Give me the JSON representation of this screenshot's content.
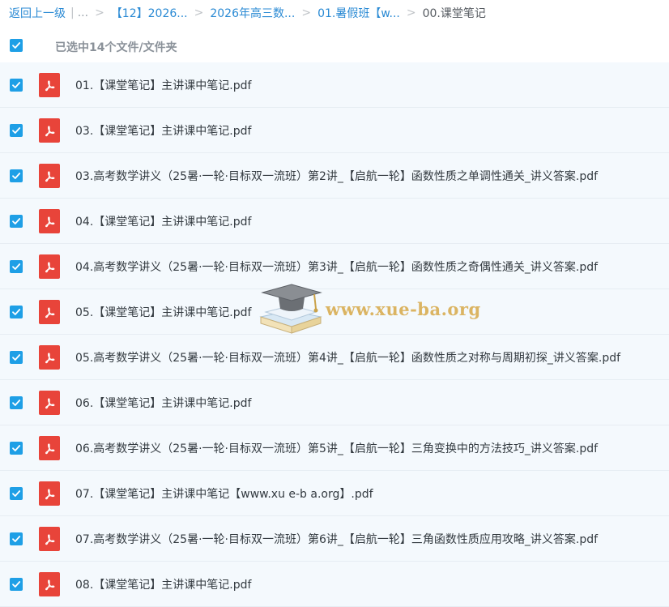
{
  "breadcrumb": {
    "back": "返回上一级",
    "ellipsis": "...",
    "crumbs": [
      "【12】2026...",
      "2026年高三数...",
      "01.暑假班【w..."
    ],
    "current": "00.课堂笔记"
  },
  "selection": {
    "text": "已选中14个文件/文件夹",
    "checked": true
  },
  "files": [
    {
      "name": "01.【课堂笔记】主讲课中笔记.pdf",
      "checked": true
    },
    {
      "name": "03.【课堂笔记】主讲课中笔记.pdf",
      "checked": true
    },
    {
      "name": "03.高考数学讲义（25暑·一轮·目标双一流班）第2讲_【启航一轮】函数性质之单调性通关_讲义答案.pdf",
      "checked": true
    },
    {
      "name": "04.【课堂笔记】主讲课中笔记.pdf",
      "checked": true
    },
    {
      "name": "04.高考数学讲义（25暑·一轮·目标双一流班）第3讲_【启航一轮】函数性质之奇偶性通关_讲义答案.pdf",
      "checked": true
    },
    {
      "name": "05.【课堂笔记】主讲课中笔记.pdf",
      "checked": true
    },
    {
      "name": "05.高考数学讲义（25暑·一轮·目标双一流班）第4讲_【启航一轮】函数性质之对称与周期初探_讲义答案.pdf",
      "checked": true
    },
    {
      "name": "06.【课堂笔记】主讲课中笔记.pdf",
      "checked": true
    },
    {
      "name": "06.高考数学讲义（25暑·一轮·目标双一流班）第5讲_【启航一轮】三角变换中的方法技巧_讲义答案.pdf",
      "checked": true
    },
    {
      "name": "07.【课堂笔记】主讲课中笔记【www.xu e-b a.org】.pdf",
      "checked": true
    },
    {
      "name": "07.高考数学讲义（25暑·一轮·目标双一流班）第6讲_【启航一轮】三角函数性质应用攻略_讲义答案.pdf",
      "checked": true
    },
    {
      "name": "08.【课堂笔记】主讲课中笔记.pdf",
      "checked": true
    }
  ],
  "watermark": {
    "text": "www.xue-ba.org"
  },
  "icons": {
    "checkbox": "checkmark-icon",
    "file": "pdf-file-icon",
    "watermark": "graduation-cap-books-icon"
  },
  "colors": {
    "link": "#2a8ad4",
    "checkbox": "#1e9fe6",
    "pdf": "#e8443a",
    "row_bg": "#f4f9fd",
    "watermark": "#d6a846"
  }
}
